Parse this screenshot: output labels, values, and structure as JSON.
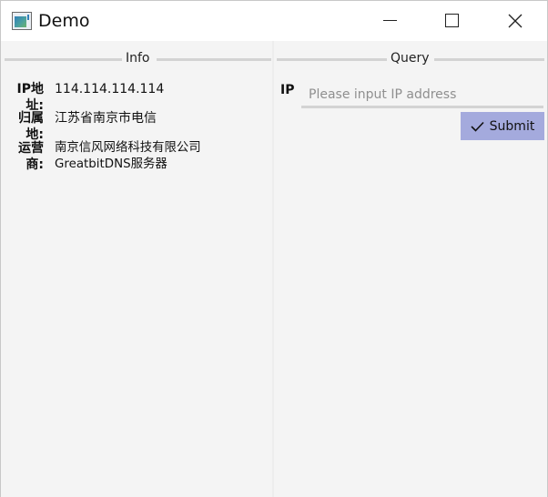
{
  "window": {
    "title": "Demo",
    "icon": "app-window-icon",
    "controls": {
      "minimize": "minimize-icon",
      "maximize": "maximize-icon",
      "close": "close-icon"
    }
  },
  "info_panel": {
    "legend": "Info",
    "rows": [
      {
        "label": "IP地址:",
        "value": "114.114.114.114"
      },
      {
        "label": "归属地:",
        "value": "江苏省南京市电信"
      },
      {
        "label": "运营商:",
        "value": "南京信风网络科技有限公司GreatbitDNS服务器"
      }
    ]
  },
  "query_panel": {
    "legend": "Query",
    "ip_label": "IP",
    "ip_input": {
      "value": "",
      "placeholder": "Please input IP address"
    },
    "submit": {
      "label": "Submit",
      "icon": "checkmark-icon",
      "color": "#a4aadd"
    }
  }
}
